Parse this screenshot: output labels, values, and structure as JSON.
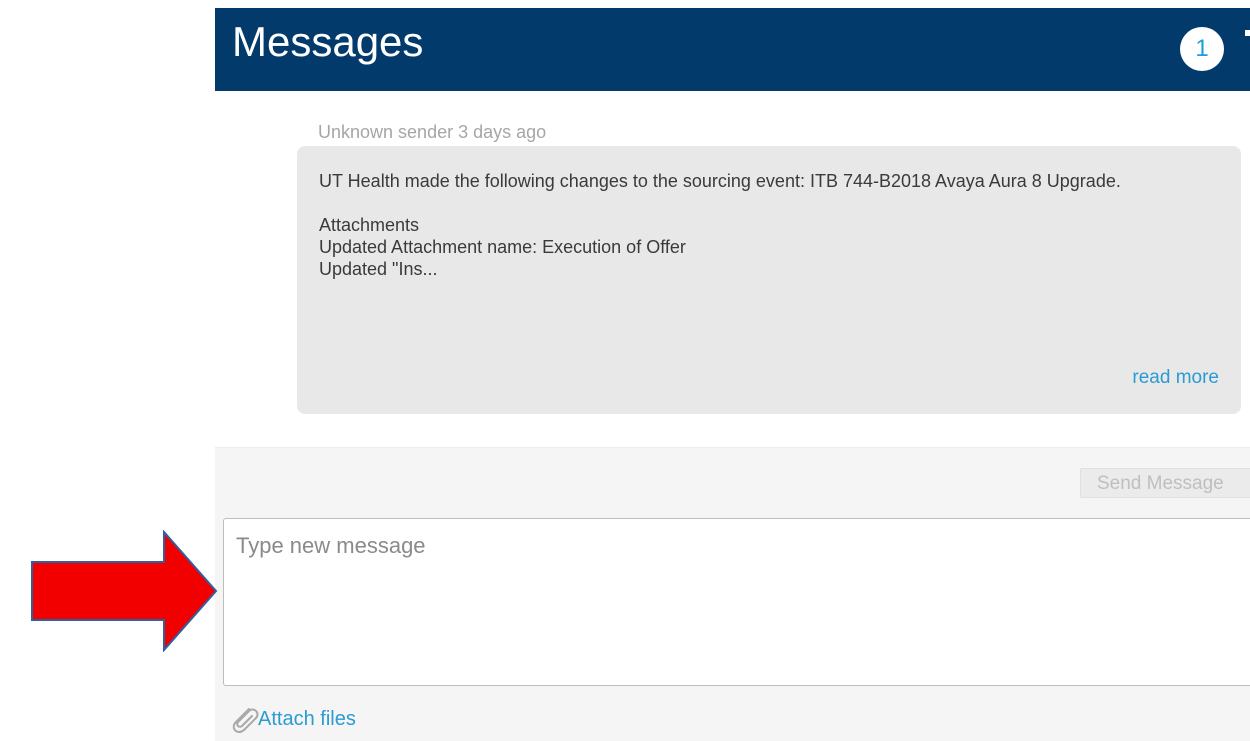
{
  "header": {
    "title": "Messages",
    "unread_count": "1"
  },
  "thread": {
    "sender_line": "Unknown sender 3 days ago",
    "message_text": "UT Health made the following changes to the sourcing event: ITB 744-B2018 Avaya Aura 8 Upgrade.\n\nAttachments\nUpdated Attachment name: Execution of Offer\nUpdated \"Ins...",
    "read_more_label": "read more"
  },
  "composer": {
    "send_label": "Send Message",
    "input_placeholder": "Type new message",
    "input_value": "",
    "attach_label": "Attach files"
  },
  "icons": {
    "attach": "paperclip-icon",
    "annotation": "red-arrow-icon"
  },
  "colors": {
    "header_bg": "#033a6c",
    "link": "#2a9bd3",
    "arrow": "#f20000"
  }
}
